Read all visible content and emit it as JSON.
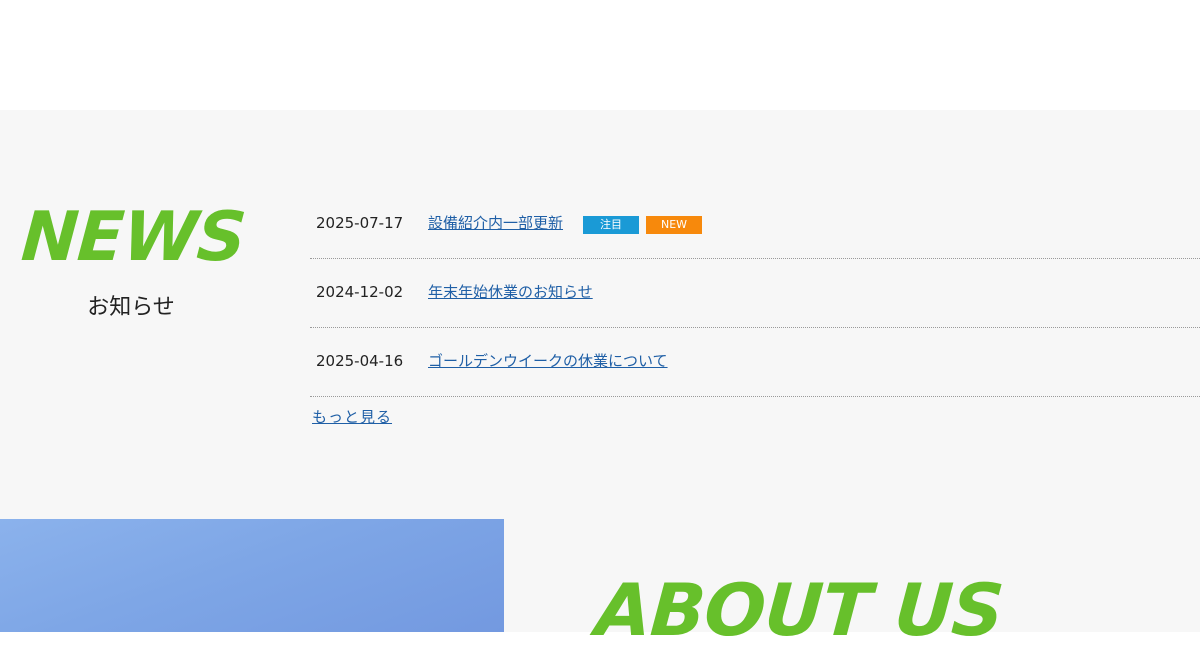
{
  "news": {
    "heading": "NEWS",
    "subheading": "お知らせ",
    "items": [
      {
        "date": "2025-07-17",
        "title": "設備紹介内一部更新",
        "tags": [
          "注目",
          "NEW"
        ]
      },
      {
        "date": "2024-12-02",
        "title": "年末年始休業のお知らせ",
        "tags": []
      },
      {
        "date": "2025-04-16",
        "title": "ゴールデンウイークの休業について",
        "tags": []
      }
    ],
    "more_label": "もっと見る"
  },
  "about": {
    "heading": "ABOUT US"
  },
  "colors": {
    "accent_green": "#67c02b",
    "link_blue": "#1f5fa6",
    "tag_featured": "#1a9ad6",
    "tag_new": "#f7890c",
    "section_bg": "#f7f7f7"
  }
}
